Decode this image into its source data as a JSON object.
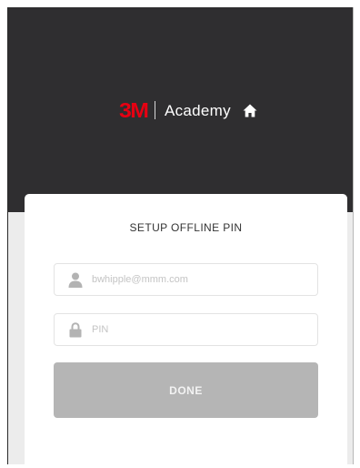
{
  "brand": {
    "logo_text": "3M",
    "name": "Academy",
    "logo_color": "#e60012",
    "home_icon": "home-icon"
  },
  "colors": {
    "header_bg": "#2f2e30",
    "page_bg": "#ececec",
    "button_bg": "#b5b5b5"
  },
  "form": {
    "title": "SETUP OFFLINE PIN",
    "email": {
      "icon": "user-icon",
      "placeholder": "bwhipple@mmm.com",
      "value": ""
    },
    "pin": {
      "icon": "lock-icon",
      "placeholder": "PIN",
      "value": ""
    },
    "done_label": "DONE"
  }
}
